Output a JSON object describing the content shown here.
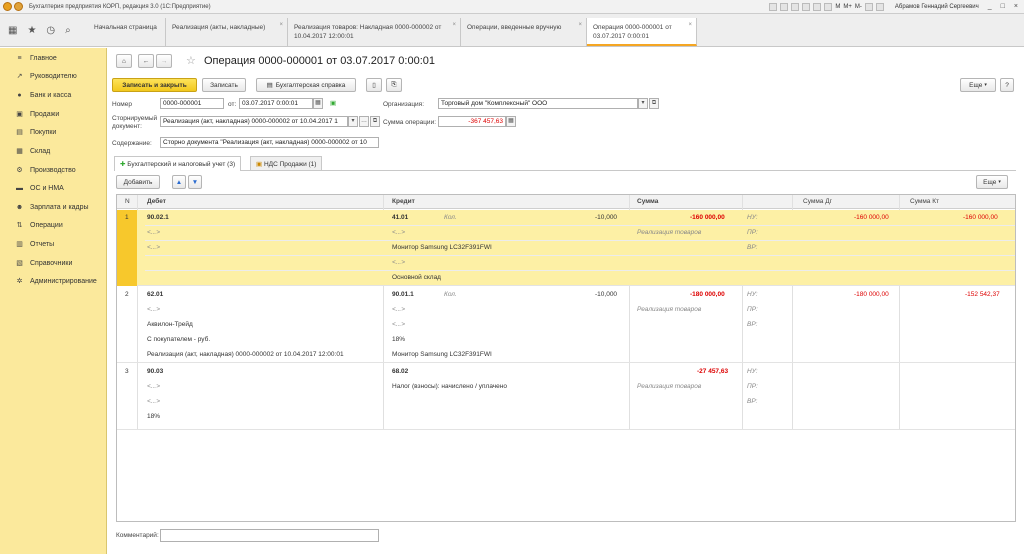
{
  "app": {
    "title": "Бухгалтерия предприятия КОРП, редакция 3.0  (1С:Предприятие)",
    "toolbar_letters": [
      "M",
      "M+",
      "M-"
    ],
    "user": "Абрамов Геннадий Сергеевич",
    "window_controls": [
      "_",
      "□",
      "×"
    ]
  },
  "open_tabs": [
    {
      "label": "Начальная страница"
    },
    {
      "label": "Реализация (акты, накладные)"
    },
    {
      "label": "Реализация товаров: Накладная 0000-000002 от 10.04.2017 12:00:01"
    },
    {
      "label": "Операции, введенные вручную"
    },
    {
      "label": "Операция 0000-000001 от 03.07.2017 0:00:01"
    }
  ],
  "sidebar": {
    "items": [
      {
        "label": "Главное",
        "icon": "≡"
      },
      {
        "label": "Руководителю",
        "icon": "↗"
      },
      {
        "label": "Банк и касса",
        "icon": "●"
      },
      {
        "label": "Продажи",
        "icon": "▣"
      },
      {
        "label": "Покупки",
        "icon": "▤"
      },
      {
        "label": "Склад",
        "icon": "▦"
      },
      {
        "label": "Производство",
        "icon": "⚙"
      },
      {
        "label": "ОС и НМА",
        "icon": "▬"
      },
      {
        "label": "Зарплата и кадры",
        "icon": "☻"
      },
      {
        "label": "Операции",
        "icon": "⇅"
      },
      {
        "label": "Отчеты",
        "icon": "▥"
      },
      {
        "label": "Справочники",
        "icon": "▧"
      },
      {
        "label": "Администрирование",
        "icon": "✲"
      }
    ]
  },
  "form": {
    "title": "Операция 0000-000001 от 03.07.2017 0:00:01",
    "buttons": {
      "save_close": "Записать и закрыть",
      "save": "Записать",
      "report": "Бухгалтерская справка",
      "more": "Еще",
      "help": "?"
    },
    "fields": {
      "number_label": "Номер",
      "number_value": "0000-000001",
      "date_label": "от:",
      "date_value": "03.07.2017  0:00:01",
      "org_label": "Организация:",
      "org_value": "Торговый дом \"Комплексный\" ООО",
      "storno_label_1": "Сторнируемый",
      "storno_label_2": "документ:",
      "storno_value": "Реализация (акт, накладная) 0000-000002 от 10.04.2017 1",
      "sum_label": "Сумма операции:",
      "sum_value": "-367 457,63",
      "content_label": "Содержание:",
      "content_value": "Сторно документа \"Реализация (акт, накладная) 0000-000002 от 10"
    },
    "subtabs": [
      {
        "label": "Бухгалтерский и налоговый учет (3)"
      },
      {
        "label": "НДС Продажи (1)"
      }
    ],
    "add_button": "Добавить",
    "table_more": "Еще",
    "comment_label": "Комментарий:"
  },
  "table": {
    "headers": {
      "n": "N",
      "debit": "Дебет",
      "credit": "Кредит",
      "sum": "Сумма",
      "sum_dt": "Сумма Дг",
      "sum_kt": "Сумма Кт"
    },
    "rows": [
      {
        "n": "1",
        "debit": [
          "90.02.1",
          "<...>",
          "<...>"
        ],
        "credit": [
          "41.01",
          "<...>",
          "Монитор Samsung LC32F391FWI",
          "<...>",
          "Основной склад"
        ],
        "qty_label": "Кол.",
        "qty": "-10,000",
        "sum": "-160 000,00",
        "sum_desc": "Реализация товаров",
        "tags": [
          "НУ:",
          "ПР:",
          "ВР:"
        ],
        "sum_dt": "-160 000,00",
        "sum_kt": "-160 000,00"
      },
      {
        "n": "2",
        "debit": [
          "62.01",
          "<...>",
          "Аквилон-Трейд",
          "С покупателем - руб.",
          "Реализация (акт, накладная) 0000-000002 от 10.04.2017 12:00:01"
        ],
        "credit": [
          "90.01.1",
          "<...>",
          "<...>",
          "18%",
          "Монитор Samsung LC32F391FWI"
        ],
        "qty_label": "Кол.",
        "qty": "-10,000",
        "sum": "-180 000,00",
        "sum_desc": "Реализация товаров",
        "tags": [
          "НУ:",
          "ПР:",
          "ВР:"
        ],
        "sum_dt": "-180 000,00",
        "sum_kt": "-152 542,37"
      },
      {
        "n": "3",
        "debit": [
          "90.03",
          "<...>",
          "<...>",
          "18%"
        ],
        "credit": [
          "68.02",
          "Налог (взносы): начислено / уплачено"
        ],
        "sum": "-27 457,63",
        "sum_desc": "Реализация товаров",
        "tags": [
          "НУ:",
          "ПР:",
          "ВР:"
        ]
      }
    ]
  }
}
